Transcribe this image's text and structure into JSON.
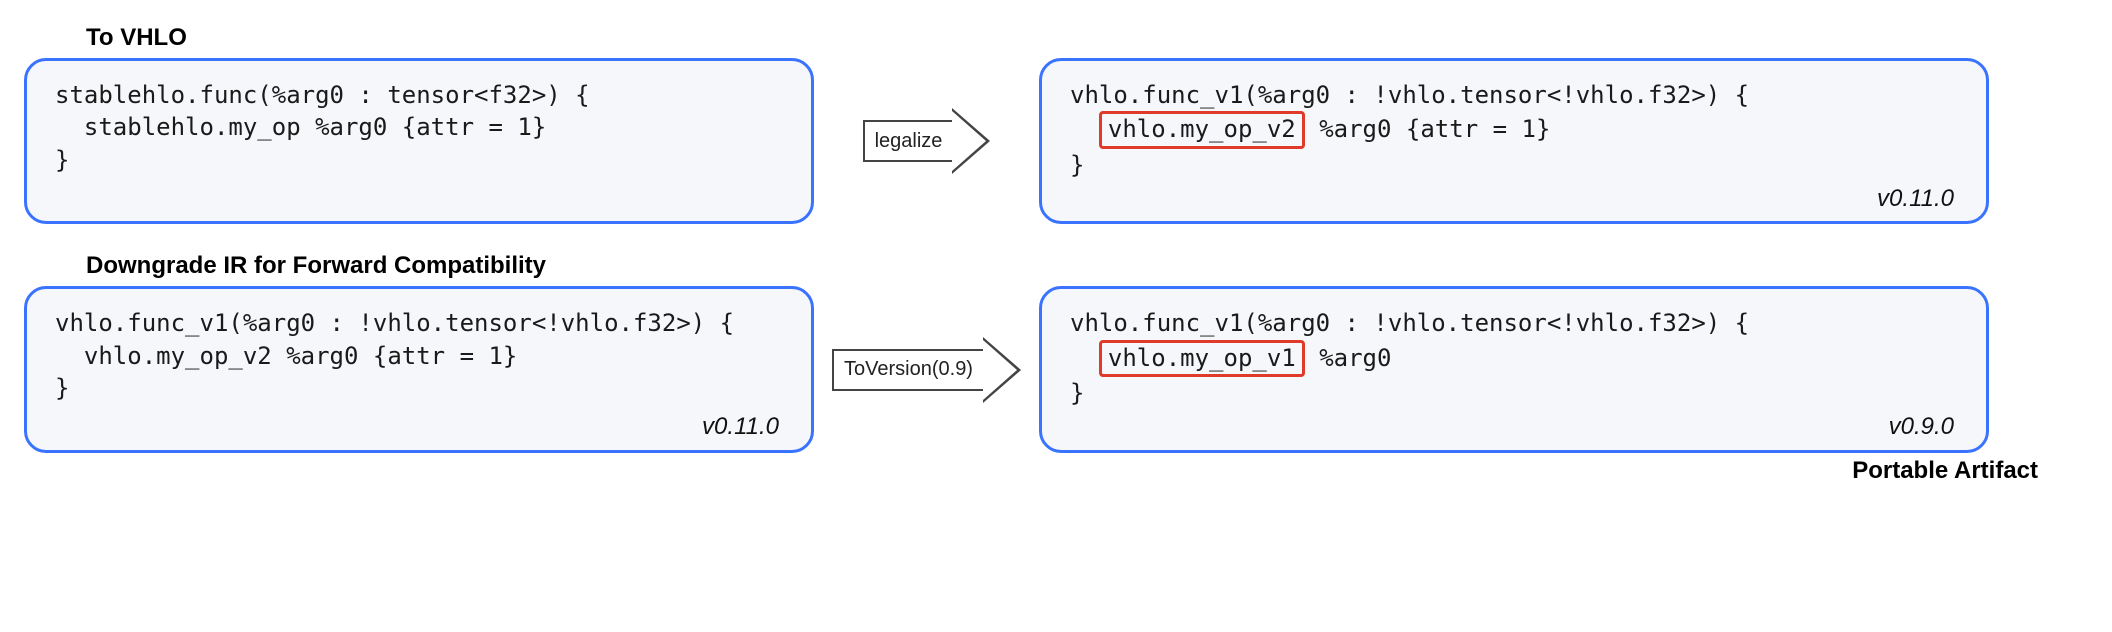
{
  "section1": {
    "title": "To VHLO",
    "left": {
      "line1": "stablehlo.func(%arg0 : tensor<f32>) {",
      "line2": "  stablehlo.my_op %arg0 {attr = 1}",
      "line3": "}"
    },
    "arrow": "legalize",
    "right": {
      "line1": "vhlo.func_v1(%arg0 : !vhlo.tensor<!vhlo.f32>) {",
      "hl": "vhlo.my_op_v2",
      "rest2": " %arg0 {attr = 1}",
      "line3": "}",
      "version": "v0.11.0"
    }
  },
  "section2": {
    "title": "Downgrade IR for Forward Compatibility",
    "left": {
      "line1": "vhlo.func_v1(%arg0 : !vhlo.tensor<!vhlo.f32>) {",
      "line2": "  vhlo.my_op_v2 %arg0 {attr = 1}",
      "line3": "}",
      "version": "v0.11.0"
    },
    "arrow": "ToVersion(0.9)",
    "right": {
      "line1": "vhlo.func_v1(%arg0 : !vhlo.tensor<!vhlo.f32>) {",
      "hl": "vhlo.my_op_v1",
      "rest2": " %arg0",
      "line3": "}",
      "version": "v0.9.0"
    },
    "footer": "Portable Artifact"
  }
}
